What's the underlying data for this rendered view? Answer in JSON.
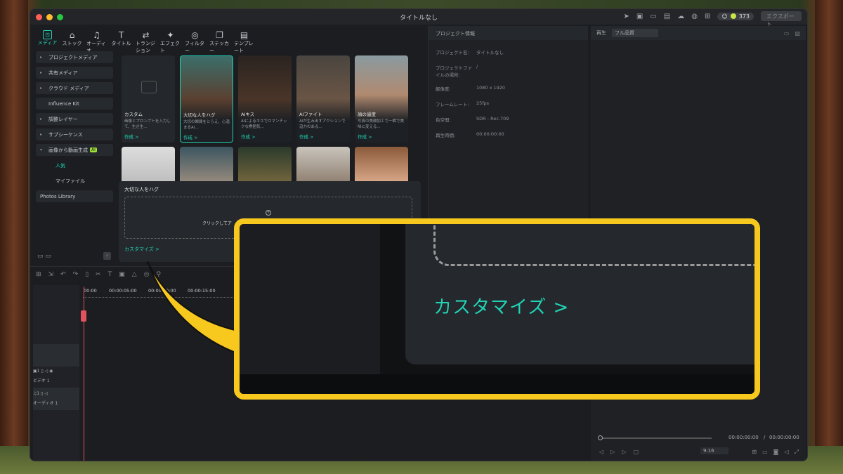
{
  "window": {
    "title": "タイトルなし",
    "credits": "373",
    "export_label": "エクスポート"
  },
  "toolbar": [
    {
      "label": "メディア",
      "icon": "media-icon",
      "active": true
    },
    {
      "label": "ストック",
      "icon": "stock-icon"
    },
    {
      "label": "オーディオ",
      "icon": "music-icon"
    },
    {
      "label": "タイトル",
      "icon": "title-icon"
    },
    {
      "label": "トランジション",
      "icon": "transition-icon"
    },
    {
      "label": "エフェクト",
      "icon": "effect-icon"
    },
    {
      "label": "フィルター",
      "icon": "filter-icon"
    },
    {
      "label": "ステッカー",
      "icon": "sticker-icon"
    },
    {
      "label": "テンプレート",
      "icon": "template-icon"
    }
  ],
  "sidebar": {
    "items": [
      "プロジェクトメディア",
      "共有メディア",
      "クラウド メディア",
      "Influence Kit",
      "調整レイヤー",
      "サブシーケンス",
      "画像から動画生成"
    ],
    "ai_badge": "AI",
    "subs": [
      "人気",
      "マイファイル"
    ],
    "photos": "Photos Library"
  },
  "grid": {
    "cards": [
      {
        "title": "カスタム",
        "desc": "画像とプロンプトを入力して、生き生...",
        "cta": "作成 >"
      },
      {
        "title": "大切な人をハグ",
        "desc": "大切の瞬間をとらえ、心温まるAI...",
        "cta": "作成 >"
      },
      {
        "title": "AIキス",
        "desc": "AIによるキスでロマンチックな雰囲気...",
        "cta": "作成 >"
      },
      {
        "title": "AIファイト",
        "desc": "AIが生み出すアクションで迫力のある...",
        "cta": "作成 >"
      },
      {
        "title": "顔の過度",
        "desc": "写真の美顔加工で一瞬で美味に変える...",
        "cta": "作成 >"
      }
    ]
  },
  "popup": {
    "heading": "大切な人をハグ",
    "drop_label": "クリックしてア",
    "customize": "カスタマイズ >"
  },
  "info": {
    "header": "プロジェクト情報",
    "rows": [
      {
        "k": "プロジェクト名:",
        "v": "タイトルなし"
      },
      {
        "k": "プロジェクトファイルの場所:",
        "v": "/"
      },
      {
        "k": "解像度:",
        "v": "1080 x 1920"
      },
      {
        "k": "フレームレート:",
        "v": "25fps"
      },
      {
        "k": "色空間:",
        "v": "SDR - Rec.709"
      },
      {
        "k": "再生時間:",
        "v": "00:00:00:00"
      }
    ]
  },
  "player": {
    "label": "再生",
    "quality": "フル品質",
    "time_current": "00:00:00:00",
    "time_sep": "/",
    "time_total": "00:00:00:00",
    "ratio": "9:16"
  },
  "timeline": {
    "ticks": [
      "00:00",
      "00:00:05:00",
      "00:00:10:00",
      "00:00:15:00"
    ],
    "video_track": "ビデオ 1",
    "audio_track": "オーディオ 1",
    "video_num": "1",
    "audio_num": "1"
  },
  "zoom": {
    "customize": "カスタマイズ >"
  },
  "colors": {
    "accent": "#21d3b6",
    "highlight": "#f7c81d"
  }
}
